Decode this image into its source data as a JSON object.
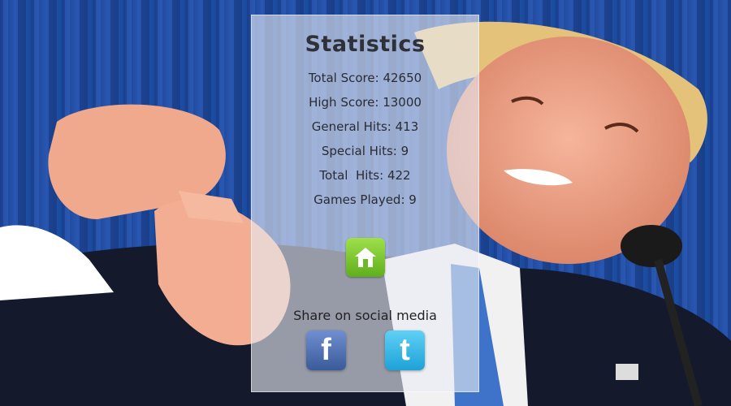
{
  "stats": {
    "title": "Statistics",
    "rows": [
      {
        "label": "Total Score:",
        "value": "42650"
      },
      {
        "label": "High Score:",
        "value": "13000"
      },
      {
        "label": "General Hits:",
        "value": "413"
      },
      {
        "label": "Special Hits:",
        "value": "9"
      },
      {
        "label": "Total  Hits:",
        "value": "422"
      },
      {
        "label": "Games Played:",
        "value": "9"
      }
    ]
  },
  "home_button": {
    "icon": "home-icon",
    "color": "#7cc936"
  },
  "share": {
    "label": "Share on social media",
    "facebook": {
      "glyph": "f",
      "color": "#3b5a9a"
    },
    "twitter": {
      "glyph": "t",
      "color": "#1ea2d8"
    }
  }
}
